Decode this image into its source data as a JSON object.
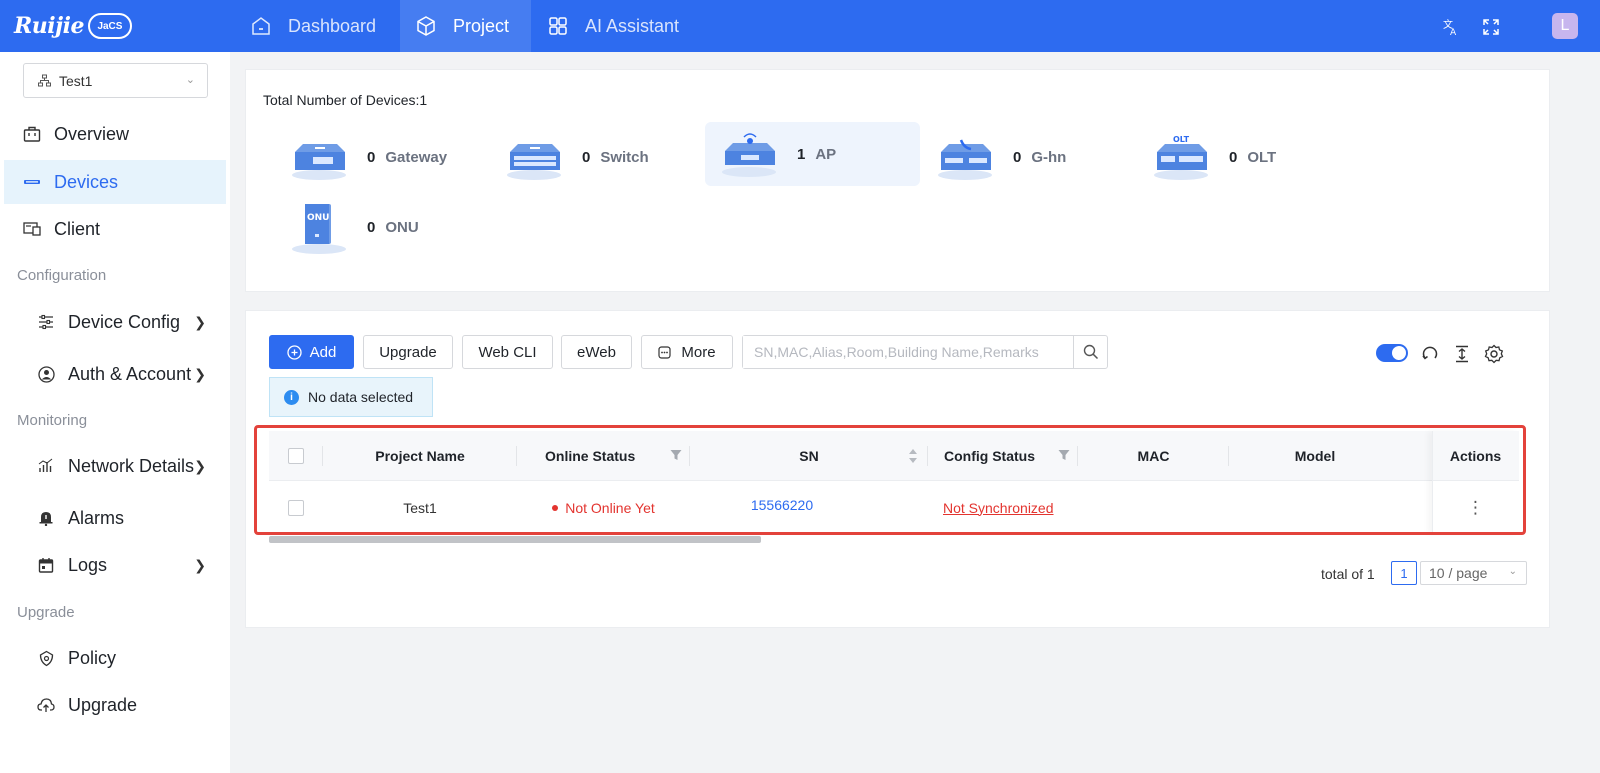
{
  "header": {
    "logo_text": "Ruijie",
    "logo_badge": "JaCS",
    "nav": [
      {
        "label": "Dashboard",
        "icon": "home-icon"
      },
      {
        "label": "Project",
        "icon": "cube-icon"
      },
      {
        "label": "AI Assistant",
        "icon": "grid-icon"
      }
    ],
    "avatar_letter": "L"
  },
  "sidebar": {
    "project_select": "Test1",
    "items": [
      {
        "label": "Overview",
        "icon": "briefcase-icon"
      },
      {
        "label": "Devices",
        "icon": "device-icon"
      },
      {
        "label": "Client",
        "icon": "client-icon"
      }
    ],
    "groups": {
      "configuration": "Configuration",
      "monitoring": "Monitoring",
      "upgrade": "Upgrade"
    },
    "config_items": [
      {
        "label": "Device Config",
        "icon": "sliders-icon"
      },
      {
        "label": "Auth & Account",
        "icon": "user-circle-icon"
      }
    ],
    "monitor_items": [
      {
        "label": "Network Details",
        "icon": "bar-chart-icon"
      },
      {
        "label": "Alarms",
        "icon": "bell-icon"
      },
      {
        "label": "Logs",
        "icon": "calendar-icon"
      }
    ],
    "upgrade_items": [
      {
        "label": "Policy",
        "icon": "shield-icon"
      },
      {
        "label": "Upgrade",
        "icon": "cloud-upload-icon"
      }
    ]
  },
  "summary": {
    "total_label": "Total Number of Devices:1",
    "devices": [
      {
        "count": "0",
        "name": "Gateway"
      },
      {
        "count": "0",
        "name": "Switch"
      },
      {
        "count": "1",
        "name": "AP"
      },
      {
        "count": "0",
        "name": "G-hn"
      },
      {
        "count": "0",
        "name": "OLT"
      },
      {
        "count": "0",
        "name": "ONU"
      }
    ],
    "olt_badge": "OLT",
    "onu_badge": "ONU"
  },
  "toolbar": {
    "add": "Add",
    "upgrade": "Upgrade",
    "webcli": "Web CLI",
    "eweb": "eWeb",
    "more": "More",
    "search_placeholder": "SN,MAC,Alias,Room,Building Name,Remarks",
    "selection_info": "No data selected"
  },
  "table": {
    "columns": [
      "Project Name",
      "Online Status",
      "SN",
      "Config Status",
      "MAC",
      "Model",
      "Actions"
    ],
    "rows": [
      {
        "project_name": "Test1",
        "online_status": "Not Online Yet",
        "sn": "15566220",
        "config_status": "Not Synchronized",
        "mac": "",
        "model": "",
        "actions": "⋮"
      }
    ]
  },
  "pagination": {
    "total": "total of 1",
    "page": "1",
    "page_size": "10 / page"
  },
  "colors": {
    "primary": "#2d6bf0",
    "offline": "#e3342f",
    "highlight_frame": "#e3423b"
  }
}
